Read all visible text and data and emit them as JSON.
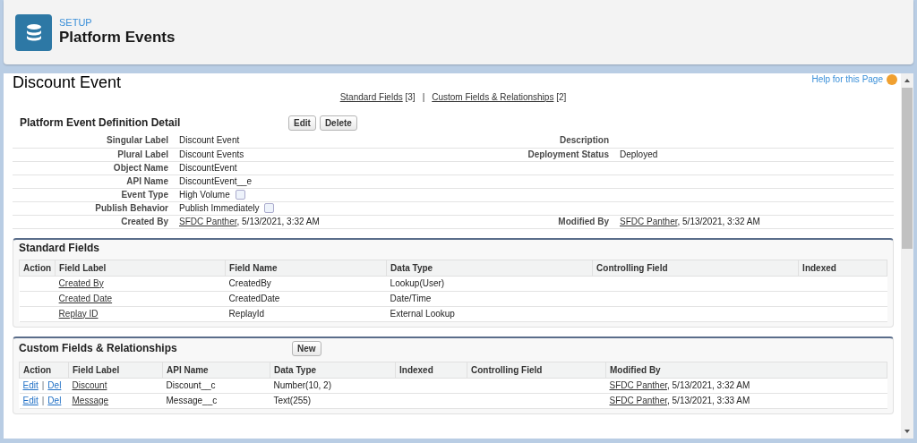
{
  "header": {
    "eyebrow": "SETUP",
    "title": "Platform Events"
  },
  "help_link": "Help for this Page",
  "record_title": "Discount Event",
  "related_links_separator": "|",
  "related_links": [
    {
      "label": "Standard Fields",
      "count": "[3]"
    },
    {
      "label": "Custom Fields & Relationships",
      "count": "[2]"
    }
  ],
  "detail": {
    "title": "Platform Event Definition Detail",
    "buttons": [
      "Edit",
      "Delete"
    ],
    "rows": [
      {
        "left": {
          "label": "Singular Label",
          "value": "Discount Event"
        },
        "right": {
          "label": "Description"
        }
      },
      {
        "left": {
          "label": "Plural Label",
          "value": "Discount Events"
        },
        "right": {
          "label": "Deployment Status",
          "value": "Deployed"
        }
      },
      {
        "left": {
          "label": "Object Name",
          "value": "DiscountEvent"
        }
      },
      {
        "left": {
          "label": "API Name",
          "value": "DiscountEvent__e"
        }
      },
      {
        "left": {
          "label": "Event Type",
          "value": "High Volume",
          "info": true
        }
      },
      {
        "left": {
          "label": "Publish Behavior",
          "value": "Publish Immediately",
          "info": true
        }
      },
      {
        "left": {
          "label": "Created By",
          "link": "SFDC Panther",
          "value": ", 5/13/2021, 3:32 AM"
        },
        "right": {
          "label": "Modified By",
          "link": "SFDC Panther",
          "value": ", 5/13/2021, 3:32 AM"
        }
      }
    ]
  },
  "standard_fields": {
    "title": "Standard Fields",
    "columns": [
      "Action",
      "Field Label",
      "Field Name",
      "Data Type",
      "Controlling Field",
      "Indexed"
    ],
    "rows": [
      {
        "field_label": "Created By",
        "field_name": "CreatedBy",
        "data_type": "Lookup(User)"
      },
      {
        "field_label": "Created Date",
        "field_name": "CreatedDate",
        "data_type": "Date/Time"
      },
      {
        "field_label": "Replay ID",
        "field_name": "ReplayId",
        "data_type": "External Lookup"
      }
    ]
  },
  "custom_fields": {
    "title": "Custom Fields & Relationships",
    "button": "New",
    "columns": [
      "Action",
      "Field Label",
      "API Name",
      "Data Type",
      "Indexed",
      "Controlling Field",
      "Modified By"
    ],
    "rows": [
      {
        "actions": [
          "Edit",
          "Del"
        ],
        "separator": "|",
        "field_label": "Discount",
        "api_name": "Discount__c",
        "data_type": "Number(10, 2)",
        "modified_link": "SFDC Panther",
        "modified_text": ", 5/13/2021, 3:32 AM"
      },
      {
        "actions": [
          "Edit",
          "Del"
        ],
        "separator": "|",
        "field_label": "Message",
        "api_name": "Message__c",
        "data_type": "Text(255)",
        "modified_link": "SFDC Panther",
        "modified_text": ", 5/13/2021, 3:33 AM"
      }
    ]
  }
}
